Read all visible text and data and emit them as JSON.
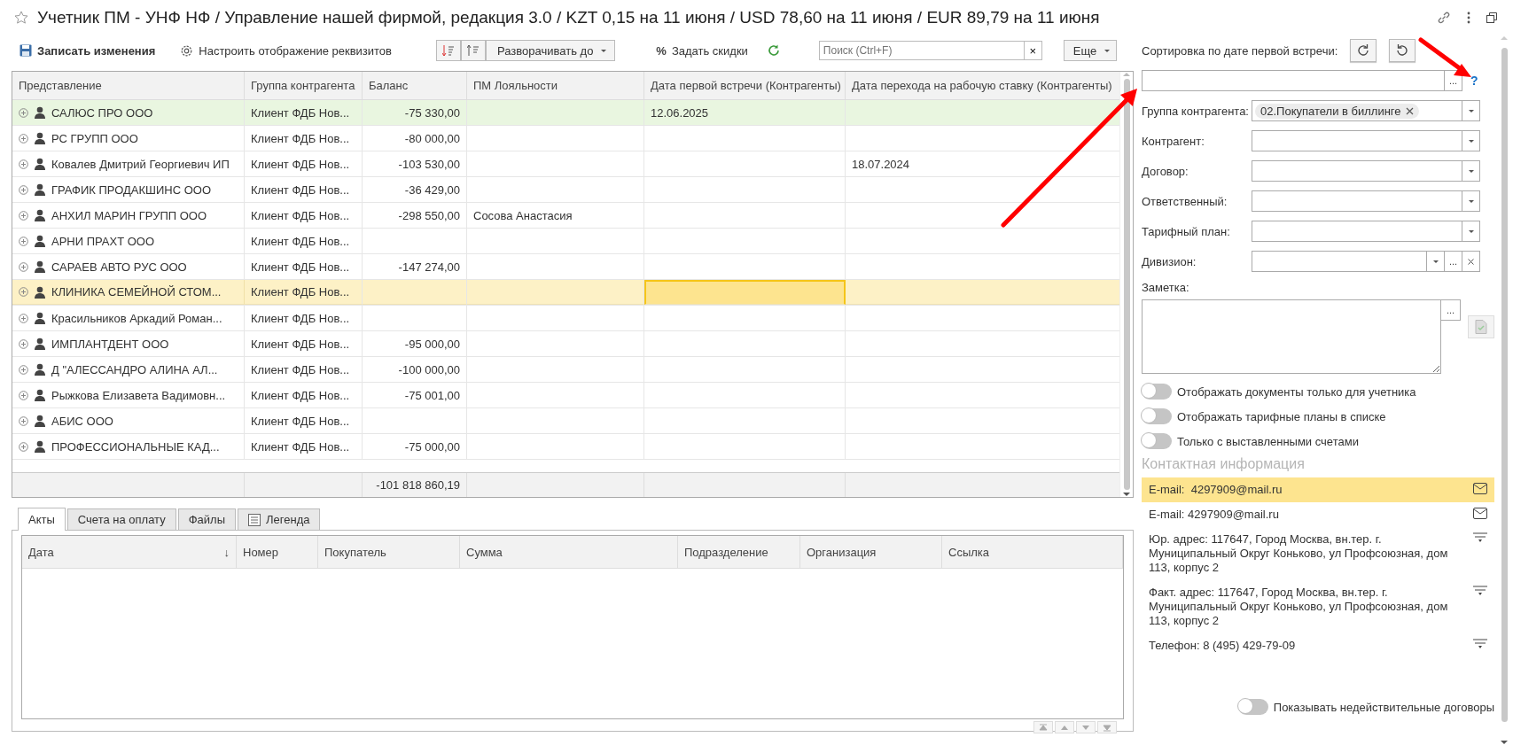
{
  "window": {
    "title": "Учетник ПМ - УНФ НФ / Управление нашей фирмой, редакция 3.0 / KZT 0,15 на 11 июня / USD 78,60 на 11 июня / EUR 89,79 на 11 июня",
    "favorite": false
  },
  "toolbar": {
    "save": "Записать изменения",
    "settings": "Настроить отображение реквизитов",
    "expand": "Разворачивать до",
    "discount_icon": "%",
    "discounts": "Задать скидки",
    "search": {
      "placeholder": "Поиск (Ctrl+F)"
    },
    "clear": "×",
    "more": "Еще"
  },
  "table": {
    "columns": [
      {
        "title": "Представление",
        "current": false
      },
      {
        "title": "Группа контрагента",
        "current": false
      },
      {
        "title": "Баланс",
        "current": false
      },
      {
        "title": "ПМ Лояльности",
        "current": false
      },
      {
        "title": "Дата первой встречи (Контрагенты)",
        "current": true
      },
      {
        "title": "Дата перехода на рабочую ставку (Контрагенты)",
        "current": false
      }
    ],
    "rows": [
      {
        "name": "САЛЮС ПРО ООО",
        "group": "Клиент ФДБ Нов...",
        "balance": "-75 330,00",
        "first_meeting": "12.06.2025",
        "highlighted": true,
        "selected": false
      },
      {
        "name": "РС ГРУПП ООО",
        "group": "Клиент ФДБ Нов...",
        "balance": "-80 000,00",
        "highlighted": false,
        "selected": false
      },
      {
        "name": "Ковалев Дмитрий Георгиевич ИП",
        "group": "Клиент ФДБ Нов...",
        "balance": "-103 530,00",
        "rate_date": "18.07.2024",
        "highlighted": false,
        "selected": false
      },
      {
        "name": "ГРАФИК ПРОДАКШИНС ООО",
        "group": "Клиент ФДБ Нов...",
        "balance": "-36 429,00",
        "highlighted": false,
        "selected": false
      },
      {
        "name": "АНХИЛ МАРИН ГРУПП ООО",
        "group": "Клиент ФДБ Нов...",
        "balance": "-298 550,00",
        "loyalty": "Сосова Анастасия",
        "highlighted": false,
        "selected": false
      },
      {
        "name": "АРНИ ПРАХТ ООО",
        "group": "Клиент ФДБ Нов...",
        "highlighted": false,
        "selected": false
      },
      {
        "name": "САРАЕВ АВТО РУС ООО",
        "group": "Клиент ФДБ Нов...",
        "balance": "-147 274,00",
        "highlighted": false,
        "selected": false
      },
      {
        "name": "КЛИНИКА СЕМЕЙНОЙ СТОМ...",
        "group": "Клиент ФДБ Нов...",
        "highlighted": false,
        "selected": true
      },
      {
        "name": "Красильников Аркадий Роман...",
        "group": "Клиент ФДБ Нов...",
        "highlighted": false,
        "selected": false
      },
      {
        "name": "ИМПЛАНТДЕНТ ООО",
        "group": "Клиент ФДБ Нов...",
        "balance": "-95 000,00",
        "highlighted": false,
        "selected": false
      },
      {
        "name": "Д \"АЛЕССАНДРО АЛИНА АЛ...",
        "group": "Клиент ФДБ Нов...",
        "balance": "-100 000,00",
        "highlighted": false,
        "selected": false
      },
      {
        "name": "Рыжкова Елизавета Вадимовн...",
        "group": "Клиент ФДБ Нов...",
        "balance": "-75 001,00",
        "highlighted": false,
        "selected": false
      },
      {
        "name": "АБИС ООО",
        "group": "Клиент ФДБ Нов...",
        "highlighted": false,
        "selected": false
      },
      {
        "name": "ПРОФЕССИОНАЛЬНЫЕ КАД...",
        "group": "Клиент ФДБ Нов...",
        "balance": "-75 000,00",
        "highlighted": false,
        "selected": false
      }
    ],
    "total": {
      "balance": "-101 818 860,19"
    }
  },
  "bottom": {
    "tabs": [
      {
        "label": "Акты",
        "selected": true,
        "kind": "text"
      },
      {
        "label": "Счета на оплату",
        "selected": false,
        "kind": "text"
      },
      {
        "label": "Файлы",
        "selected": false,
        "kind": "text"
      },
      {
        "label": "Легенда",
        "selected": false,
        "kind": "with_icon"
      }
    ],
    "columns": [
      {
        "title": "Дата",
        "sort": "↓"
      },
      {
        "title": "Номер"
      },
      {
        "title": "Покупатель"
      },
      {
        "title": "Сумма"
      },
      {
        "title": "Подразделение"
      },
      {
        "title": "Организация"
      },
      {
        "title": "Ссылка"
      }
    ]
  },
  "side": {
    "sort_label": "Сортировка по дате первой встречи:",
    "field_button": "...",
    "help": "?",
    "filters": [
      {
        "label": "Группа контрагента:",
        "kind": "select",
        "tag": "02.Покупатели в биллинге"
      },
      {
        "label": "Контрагент:",
        "kind": "select"
      },
      {
        "label": "Договор:",
        "kind": "select"
      },
      {
        "label": "Ответственный:",
        "kind": "select"
      },
      {
        "label": "Тарифный план:",
        "kind": "select"
      },
      {
        "label": "Дивизион:",
        "kind": "select_clear",
        "button": "..."
      }
    ],
    "note": {
      "label": "Заметка:",
      "button": "..."
    },
    "toggles": [
      {
        "label": "Отображать документы только для учетника",
        "on": false
      },
      {
        "label": "Отображать тарифные планы в списке",
        "on": false
      },
      {
        "label": "Только с выставленными счетами",
        "on": false
      }
    ],
    "contacts": {
      "title": "Контактная информация",
      "items": [
        {
          "kind": "email",
          "text": "E-mail:  4297909@mail.ru",
          "selected": true
        },
        {
          "kind": "email",
          "text": "E-mail: 4297909@mail.ru",
          "selected": false
        },
        {
          "kind": "address",
          "text": "Юр. адрес: 117647, Город Москва, вн.тер. г. Муниципальный Округ Коньково, ул Профсоюзная, дом 113, корпус 2",
          "selected": false
        },
        {
          "kind": "address",
          "text": "Факт. адрес: 117647, Город Москва, вн.тер. г. Муниципальный Округ Коньково, ул Профсоюзная, дом 113, корпус 2",
          "selected": false
        },
        {
          "kind": "phone",
          "text": "Телефон: 8 (495) 429-79-09",
          "selected": false
        }
      ]
    },
    "bottom_toggle": {
      "label": "Показывать недействительные договоры",
      "on": false
    }
  }
}
